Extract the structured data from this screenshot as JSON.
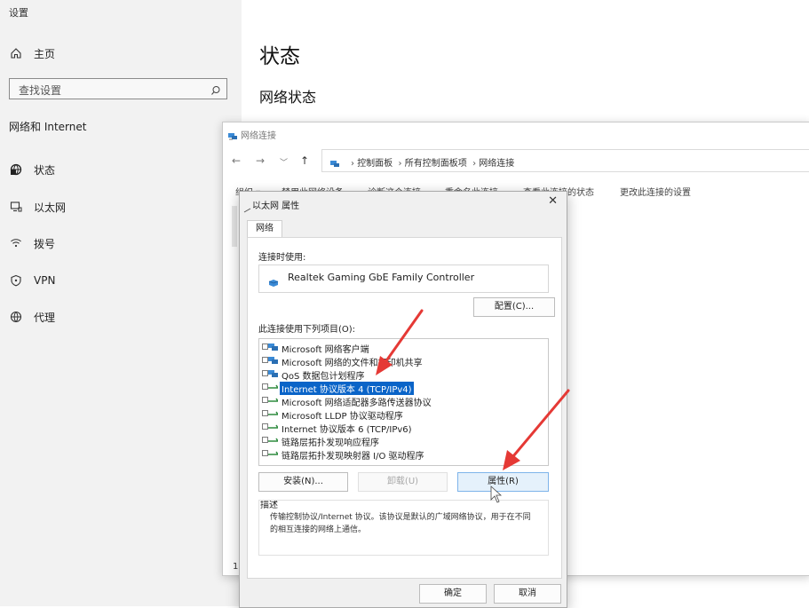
{
  "settings": {
    "app_title": "设置",
    "home": "主页",
    "search_placeholder": "查找设置",
    "section": "网络和 Internet",
    "nav": [
      {
        "label": "状态",
        "icon": "globe-icon"
      },
      {
        "label": "以太网",
        "icon": "monitor-icon"
      },
      {
        "label": "拨号",
        "icon": "wifi-icon"
      },
      {
        "label": "VPN",
        "icon": "vpn-shield-icon"
      },
      {
        "label": "代理",
        "icon": "proxy-globe-icon"
      }
    ],
    "page_title": "状态",
    "page_subtitle": "网络状态"
  },
  "explorer": {
    "title": "网络连接",
    "breadcrumbs": [
      "控制面板",
      "所有控制面板项",
      "网络连接"
    ],
    "commands": [
      "组织 ▾",
      "禁用此网络设备",
      "诊断这个连接",
      "重命名此连接",
      "查看此连接的状态",
      "更改此连接的设置"
    ],
    "left_number": "1"
  },
  "dialog": {
    "title": "以太网 属性",
    "close": "✕",
    "tab": "网络",
    "connect_using_label": "连接时使用:",
    "adapter_name": "Realtek Gaming GbE Family Controller",
    "configure_button": "配置(C)...",
    "items_label": "此连接使用下列项目(O):",
    "items": [
      {
        "label": "Microsoft 网络客户端",
        "icon": "network-client-icon",
        "selected": false
      },
      {
        "label": "Microsoft 网络的文件和打印机共享",
        "icon": "file-share-icon",
        "selected": false
      },
      {
        "label": "QoS 数据包计划程序",
        "icon": "qos-icon",
        "selected": false
      },
      {
        "label": "Internet 协议版本 4 (TCP/IPv4)",
        "icon": "protocol-icon",
        "selected": true
      },
      {
        "label": "Microsoft 网络适配器多路传送器协议",
        "icon": "protocol-icon",
        "selected": false
      },
      {
        "label": "Microsoft LLDP 协议驱动程序",
        "icon": "protocol-icon",
        "selected": false
      },
      {
        "label": "Internet 协议版本 6 (TCP/IPv6)",
        "icon": "protocol-icon",
        "selected": false
      },
      {
        "label": "链路层拓扑发现响应程序",
        "icon": "protocol-icon",
        "selected": false
      },
      {
        "label": "链路层拓扑发现映射器 I/O 驱动程序",
        "icon": "protocol-icon",
        "selected": false
      }
    ],
    "install_button": "安装(N)...",
    "uninstall_button": "卸载(U)",
    "properties_button": "属性(R)",
    "description_label": "描述",
    "description_text": "传输控制协议/Internet 协议。该协议是默认的广域网络协议，用于在不同的相互连接的网络上通信。",
    "ok_button": "确定",
    "cancel_button": "取消"
  },
  "colors": {
    "selection": "#0a64c8",
    "annotation_arrow": "#e53935"
  }
}
